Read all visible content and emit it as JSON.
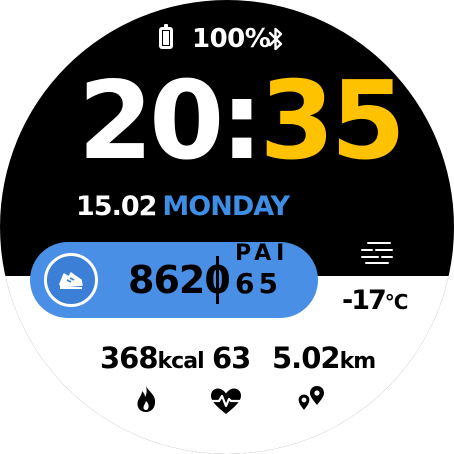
{
  "status": {
    "battery": "100%"
  },
  "time": {
    "hours": "20",
    "separator": ":",
    "minutes": "35"
  },
  "date": {
    "day_month": "15.02",
    "weekday": "MONDAY"
  },
  "activity": {
    "steps": "8620",
    "pai_label": "PAI",
    "pai_value": "65"
  },
  "weather": {
    "temperature": "-17",
    "unit": "°C"
  },
  "stats": {
    "calories": "368",
    "calories_unit": "kcal",
    "heart_rate": "63",
    "distance": "5.02",
    "distance_unit": "km"
  },
  "colors": {
    "accent_yellow": "#ffc200",
    "accent_blue": "#4a8fe6"
  },
  "icons": [
    "battery-icon",
    "bluetooth-icon",
    "shoe-icon",
    "weather-icon",
    "flame-icon",
    "heart-icon",
    "pin-icon"
  ]
}
